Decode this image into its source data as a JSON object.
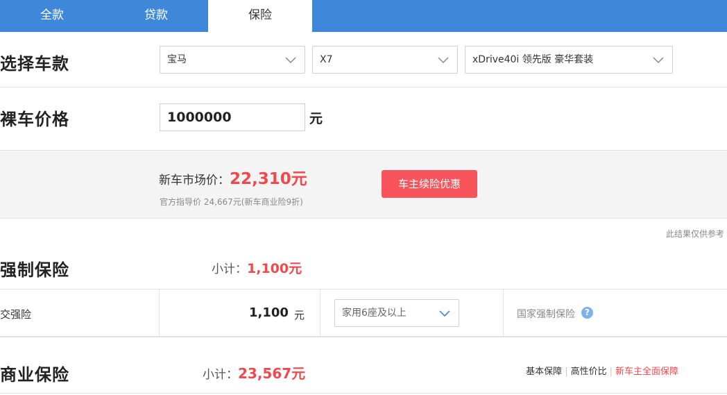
{
  "tabs": [
    {
      "label": "全款"
    },
    {
      "label": "贷款"
    },
    {
      "label": "保险"
    }
  ],
  "select_model": {
    "title": "选择车款",
    "brand": "宝马",
    "series": "X7",
    "trim": "xDrive40i 领先版 豪华套装"
  },
  "bare_price": {
    "title": "裸车价格",
    "value": "1000000",
    "unit": "元"
  },
  "market": {
    "label": "新车市场价：",
    "price": "22,310元",
    "note": "官方指导价 24,667元(新车商业险9折)",
    "promo_button": "车主续险优惠"
  },
  "disclaimer": "此结果仅供参考",
  "compulsory": {
    "title": "强制保险",
    "subtotal_label": "小计：",
    "subtotal_value": "1,100元",
    "row": {
      "name": "交强险",
      "amount": "1,100",
      "unit": "元",
      "seat_option": "家用6座及以上",
      "desc": "国家强制保险"
    }
  },
  "commercial": {
    "title": "商业保险",
    "subtotal_label": "小计：",
    "subtotal_value": "23,567元",
    "links": [
      "基本保障",
      "高性价比",
      "新车主全面保障"
    ]
  },
  "colors": {
    "tab_bar": "#3f87d9",
    "highlight_red": "#f0494d",
    "promo_button": "#f7555b",
    "help_icon": "#7db2ea"
  },
  "icons": {
    "dropdown": "chevron-down-icon",
    "help": "question-mark-icon"
  }
}
